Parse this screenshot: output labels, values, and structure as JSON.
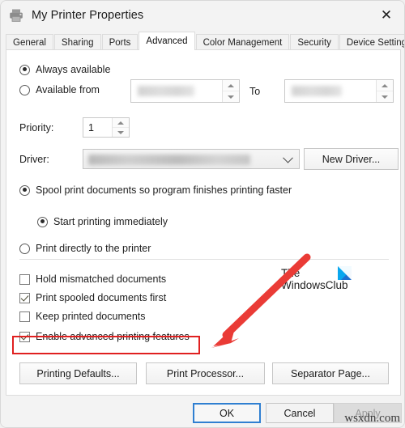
{
  "window": {
    "title": "My Printer Properties",
    "icon": "printer-icon",
    "close_label": "✕"
  },
  "tabs": [
    {
      "label": "General",
      "active": false
    },
    {
      "label": "Sharing",
      "active": false
    },
    {
      "label": "Ports",
      "active": false
    },
    {
      "label": "Advanced",
      "active": true
    },
    {
      "label": "Color Management",
      "active": false
    },
    {
      "label": "Security",
      "active": false
    },
    {
      "label": "Device Settings",
      "active": false
    }
  ],
  "advanced": {
    "availability": {
      "always_available_label": "Always available",
      "always_available_checked": true,
      "available_from_label": "Available from",
      "available_from_checked": false,
      "from_time_value": "",
      "to_label": "To",
      "to_time_value": ""
    },
    "priority": {
      "label": "Priority:",
      "value": "1"
    },
    "driver": {
      "label": "Driver:",
      "value": "",
      "new_driver_button": "New Driver..."
    },
    "spooling": {
      "spool_label": "Spool print documents so program finishes printing faster",
      "spool_checked": true,
      "start_immediately_label": "Start printing immediately",
      "start_immediately_checked": true,
      "print_directly_label": "Print directly to the printer",
      "print_directly_checked": false
    },
    "options": [
      {
        "label": "Hold mismatched documents",
        "checked": false,
        "highlighted": false
      },
      {
        "label": "Print spooled documents first",
        "checked": true,
        "highlighted": false
      },
      {
        "label": "Keep printed documents",
        "checked": false,
        "highlighted": false
      },
      {
        "label": "Enable advanced printing features",
        "checked": true,
        "highlighted": true
      }
    ],
    "action_buttons": [
      {
        "label": "Printing Defaults..."
      },
      {
        "label": "Print Processor..."
      },
      {
        "label": "Separator Page..."
      }
    ]
  },
  "footer_buttons": [
    {
      "label": "OK",
      "state": "focused"
    },
    {
      "label": "Cancel",
      "state": "normal"
    },
    {
      "label": "Apply",
      "state": "disabled"
    }
  ],
  "annotations": {
    "highlight_color": "#e02020",
    "arrow_color": "#ea3b36",
    "watermark_twc_line1": "The",
    "watermark_twc_line2": "WindowsClub",
    "watermark_site": "wsxdn.com"
  }
}
